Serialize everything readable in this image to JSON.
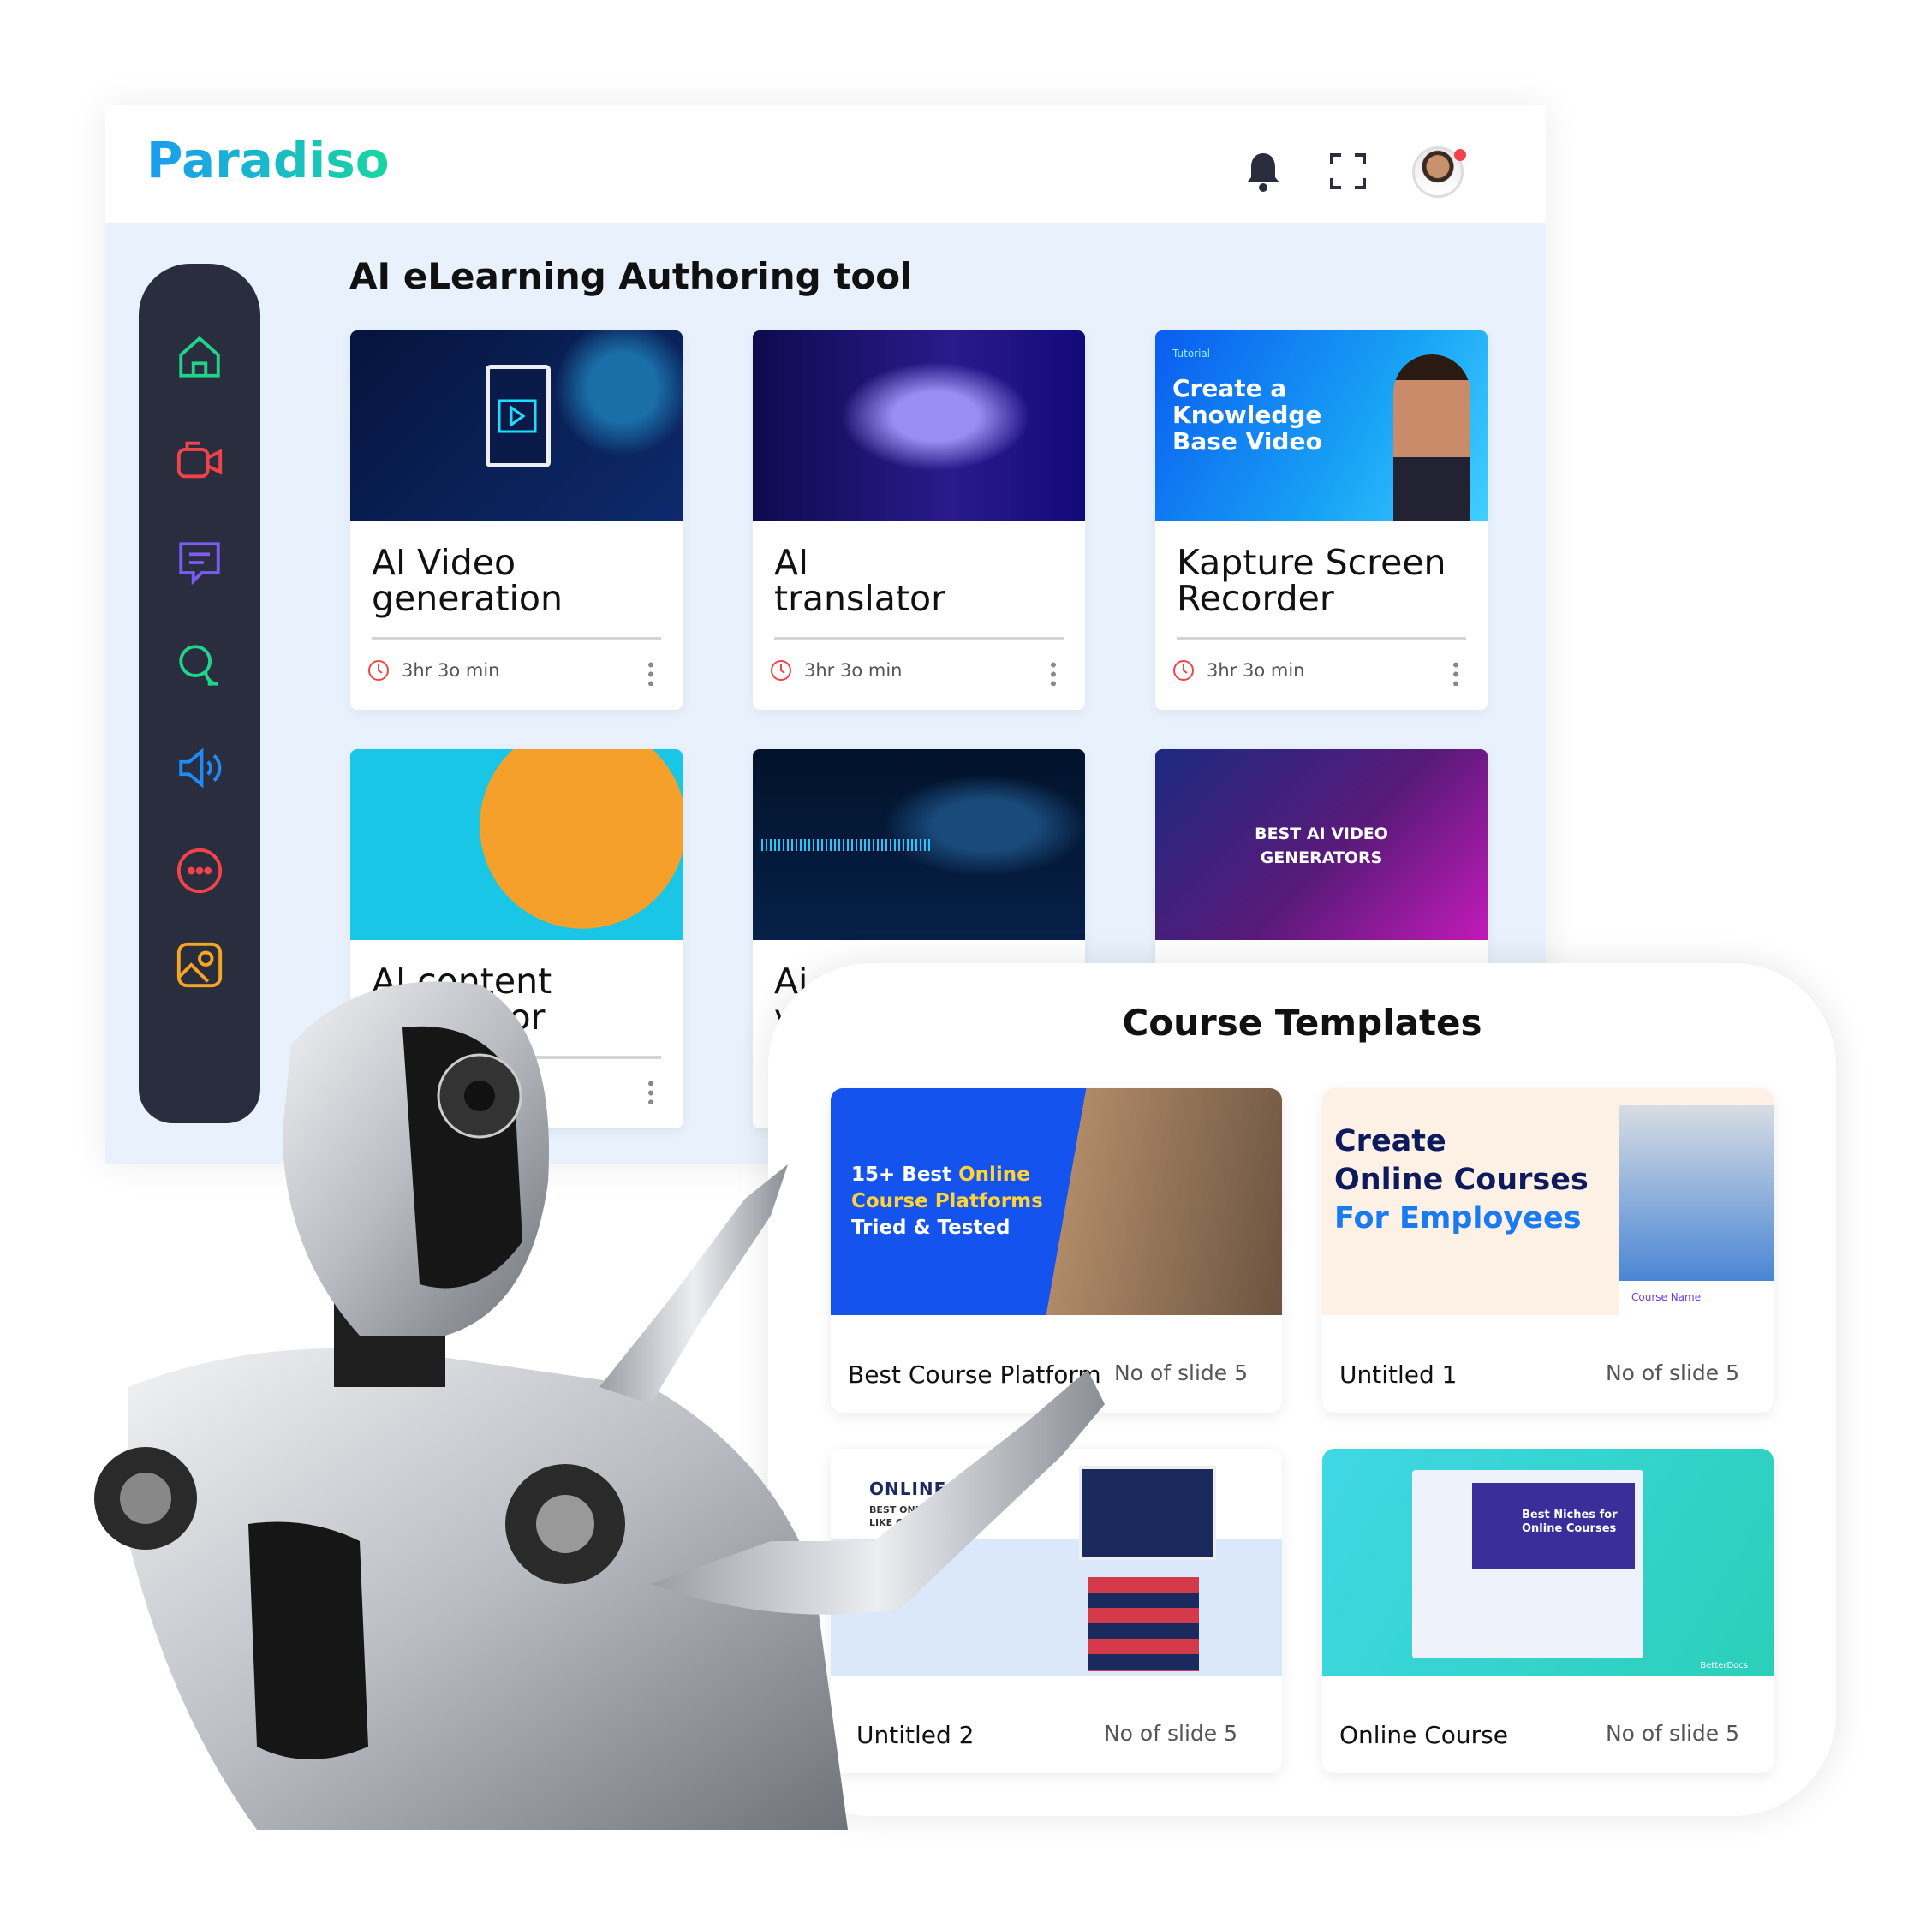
{
  "header": {
    "logo": "Paradiso",
    "icons": [
      "bell-icon",
      "fullscreen-icon",
      "avatar"
    ]
  },
  "sidebar": {
    "items": [
      {
        "icon": "home-icon",
        "color": "#22d38a"
      },
      {
        "icon": "video-camera-icon",
        "color": "#f2434a"
      },
      {
        "icon": "document-chat-icon",
        "color": "#7b5cf0"
      },
      {
        "icon": "chat-bubbles-icon",
        "color": "#22d38a"
      },
      {
        "icon": "speaker-icon",
        "color": "#1e8cf5"
      },
      {
        "icon": "more-chat-icon",
        "color": "#f2434a"
      },
      {
        "icon": "image-icon",
        "color": "#f5a623"
      }
    ]
  },
  "main": {
    "title": "AI eLearning Authoring tool",
    "cards": [
      {
        "title": "AI Video generation",
        "duration": "3hr 3o min"
      },
      {
        "title": "AI translator",
        "duration": "3hr 3o min"
      },
      {
        "title": "Kapture Screen Recorder",
        "duration": "3hr 3o min",
        "thumb_tag": "Tutorial",
        "thumb_text": "Create a Knowledge Base Video"
      },
      {
        "title": "AI content generator"
      },
      {
        "title": "Ai voice"
      },
      {
        "title": "",
        "thumb_text": "BEST AI VIDEO GENERATORS"
      }
    ]
  },
  "templates": {
    "title": "Course Templates",
    "items": [
      {
        "name": "Best Course Platform",
        "slides": "No of slide 5",
        "thumb": {
          "l1a": "15+ Best ",
          "l1b": "Online",
          "l2": "Course Platforms",
          "l3": "Tried & Tested"
        }
      },
      {
        "name": "Untitled 1",
        "slides": "No of slide 5",
        "thumb": {
          "l1": "Create",
          "l2": "Online Courses",
          "l3": "For Employees",
          "tag": "Course Name"
        }
      },
      {
        "name": "Untitled 2",
        "slides": "No of slide 5",
        "thumb": {
          "l1": "ONLINE COUR",
          "l2": "BEST ONLINE LEARNIN",
          "l3": "LIKE COURSERA"
        }
      },
      {
        "name": "Online Course",
        "slides": "No of slide 5",
        "thumb": {
          "l1": "Best Niches for",
          "l2": "Online Courses",
          "brand": "BetterDocs"
        }
      }
    ]
  },
  "colors": {
    "accent": "#1a9cf0",
    "sidebar": "#2a2d3e",
    "clock": "#f2434a"
  }
}
